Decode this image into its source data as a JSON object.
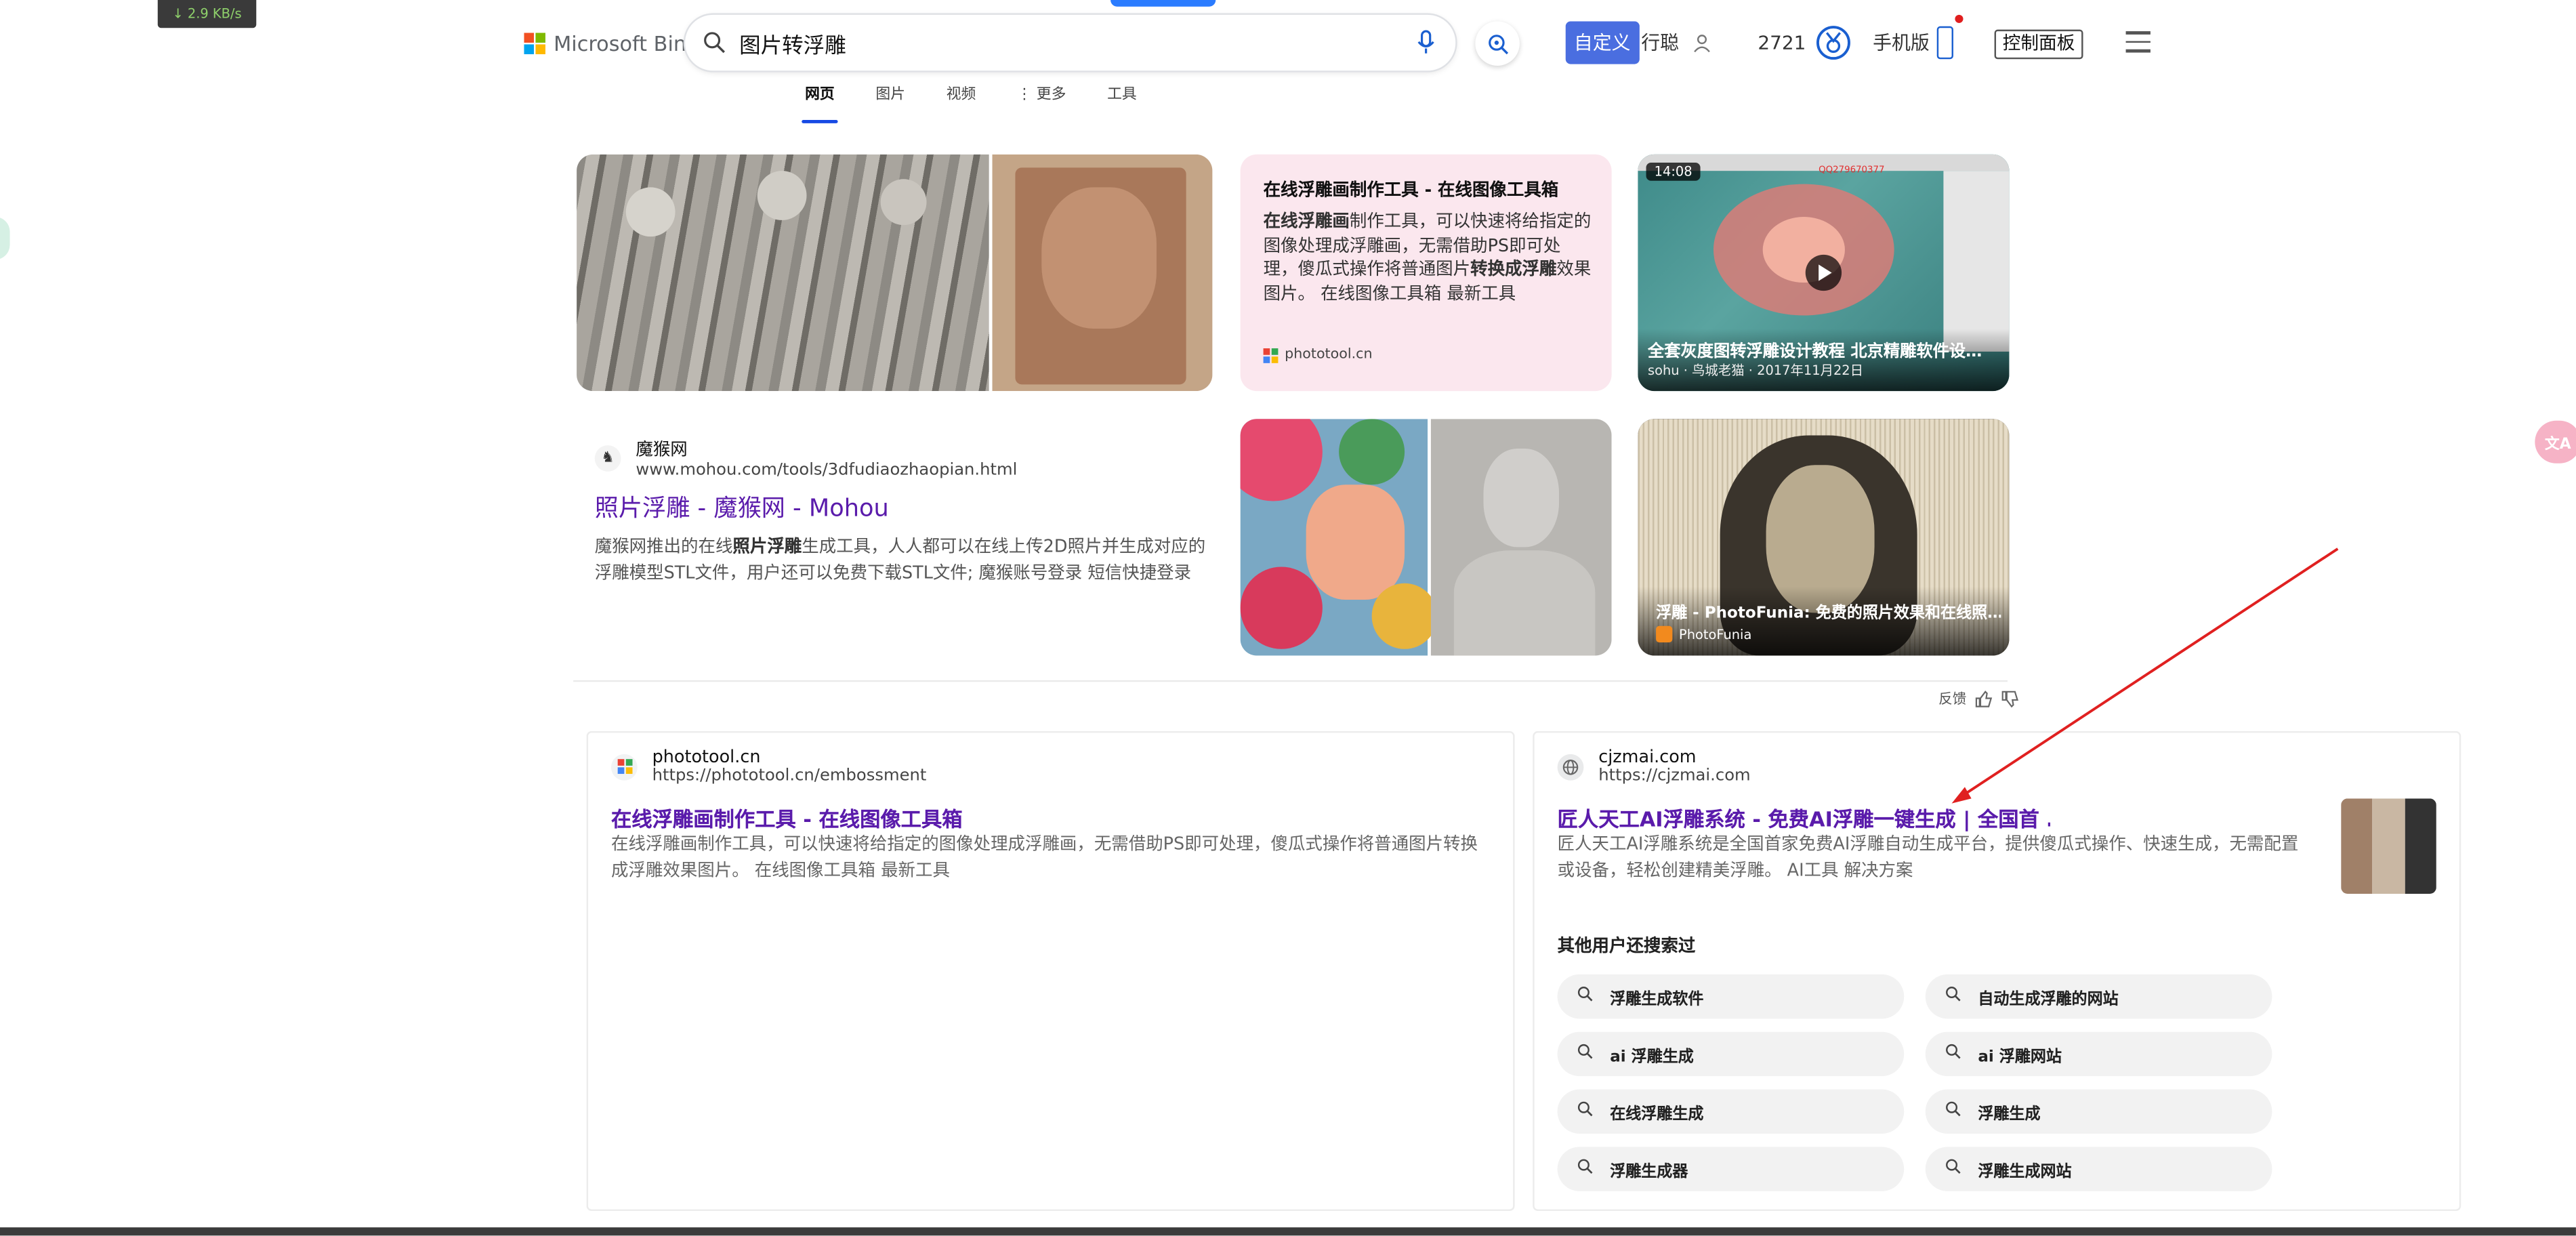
{
  "status": {
    "net_speed": "↓ 2.9 KB/s"
  },
  "header": {
    "brand": "Microsoft Bing",
    "query": "图片转浮雕",
    "customize": "自定义",
    "user_name": "行聪",
    "rewards_points": "2721",
    "mobile": "手机版",
    "control_panel": "控制面板"
  },
  "tabs": [
    "网页",
    "图片",
    "视频",
    "更多",
    "工具"
  ],
  "top_cards": {
    "text_card": {
      "title": "在线浮雕画制作工具 - 在线图像工具箱",
      "desc_parts": [
        "在线浮雕画",
        "制作工具，可以快速将给指定的图像处理成浮雕画，无需借助PS即可处理，傻瓜式操作将普通图片",
        "转换成浮雕",
        "效果图片。 在线图像工具箱 最新工具"
      ],
      "source": "phototool.cn"
    },
    "video_card": {
      "duration": "14:08",
      "watermark": "QQ279670377",
      "title": "全套灰度图转浮雕设计教程 北京精雕软件设…",
      "meta": "sohu · 鸟城老猫 · 2017年11月22日"
    },
    "mohou": {
      "site": "魔猴网",
      "url": "www.mohou.com/tools/3dfudiaozhaopian.html",
      "title": "照片浮雕 - 魔猴网 - Mohou",
      "desc_parts": [
        "魔猴网推出的在线",
        "照片浮雕",
        "生成工具，人人都可以在线上传2D照片并生成对应的浮雕模型STL文件，用户还可以免费下载STL文件; 魔猴账号登录 短信快捷登录"
      ]
    },
    "photofunia_card": {
      "title": "浮雕 - PhotoFunia: 免费的照片效果和在线照…",
      "source": "PhotoFunia"
    }
  },
  "feedback": {
    "label": "反馈"
  },
  "results": [
    {
      "site": "phototool.cn",
      "url": "https://phototool.cn/embossment",
      "title": "在线浮雕画制作工具 - 在线图像工具箱",
      "desc": "在线浮雕画制作工具，可以快速将给指定的图像处理成浮雕画，无需借助PS即可处理，傻瓜式操作将普通图片转换成浮雕效果图片。 在线图像工具箱 最新工具"
    },
    {
      "site": "cjzmai.com",
      "url": "https://cjzmai.com",
      "title": "匠人天工AI浮雕系统 - 免费AI浮雕一键生成 | 全国首 …",
      "desc": "匠人天工AI浮雕系统是全国首家免费AI浮雕自动生成平台，提供傻瓜式操作、快速生成，无需配置或设备，轻松创建精美浮雕。 AI工具 解决方案"
    }
  ],
  "related": {
    "heading": "其他用户还搜索过",
    "items": [
      "浮雕生成软件",
      "自动生成浮雕的网站",
      "ai 浮雕生成",
      "ai 浮雕网站",
      "在线浮雕生成",
      "浮雕生成",
      "浮雕生成器",
      "浮雕生成网站"
    ]
  },
  "colors": {
    "accent": "#174ae4",
    "link_visited": "#5a1bab",
    "arrow": "#e02020",
    "customize_bg": "#4a6ee0"
  }
}
